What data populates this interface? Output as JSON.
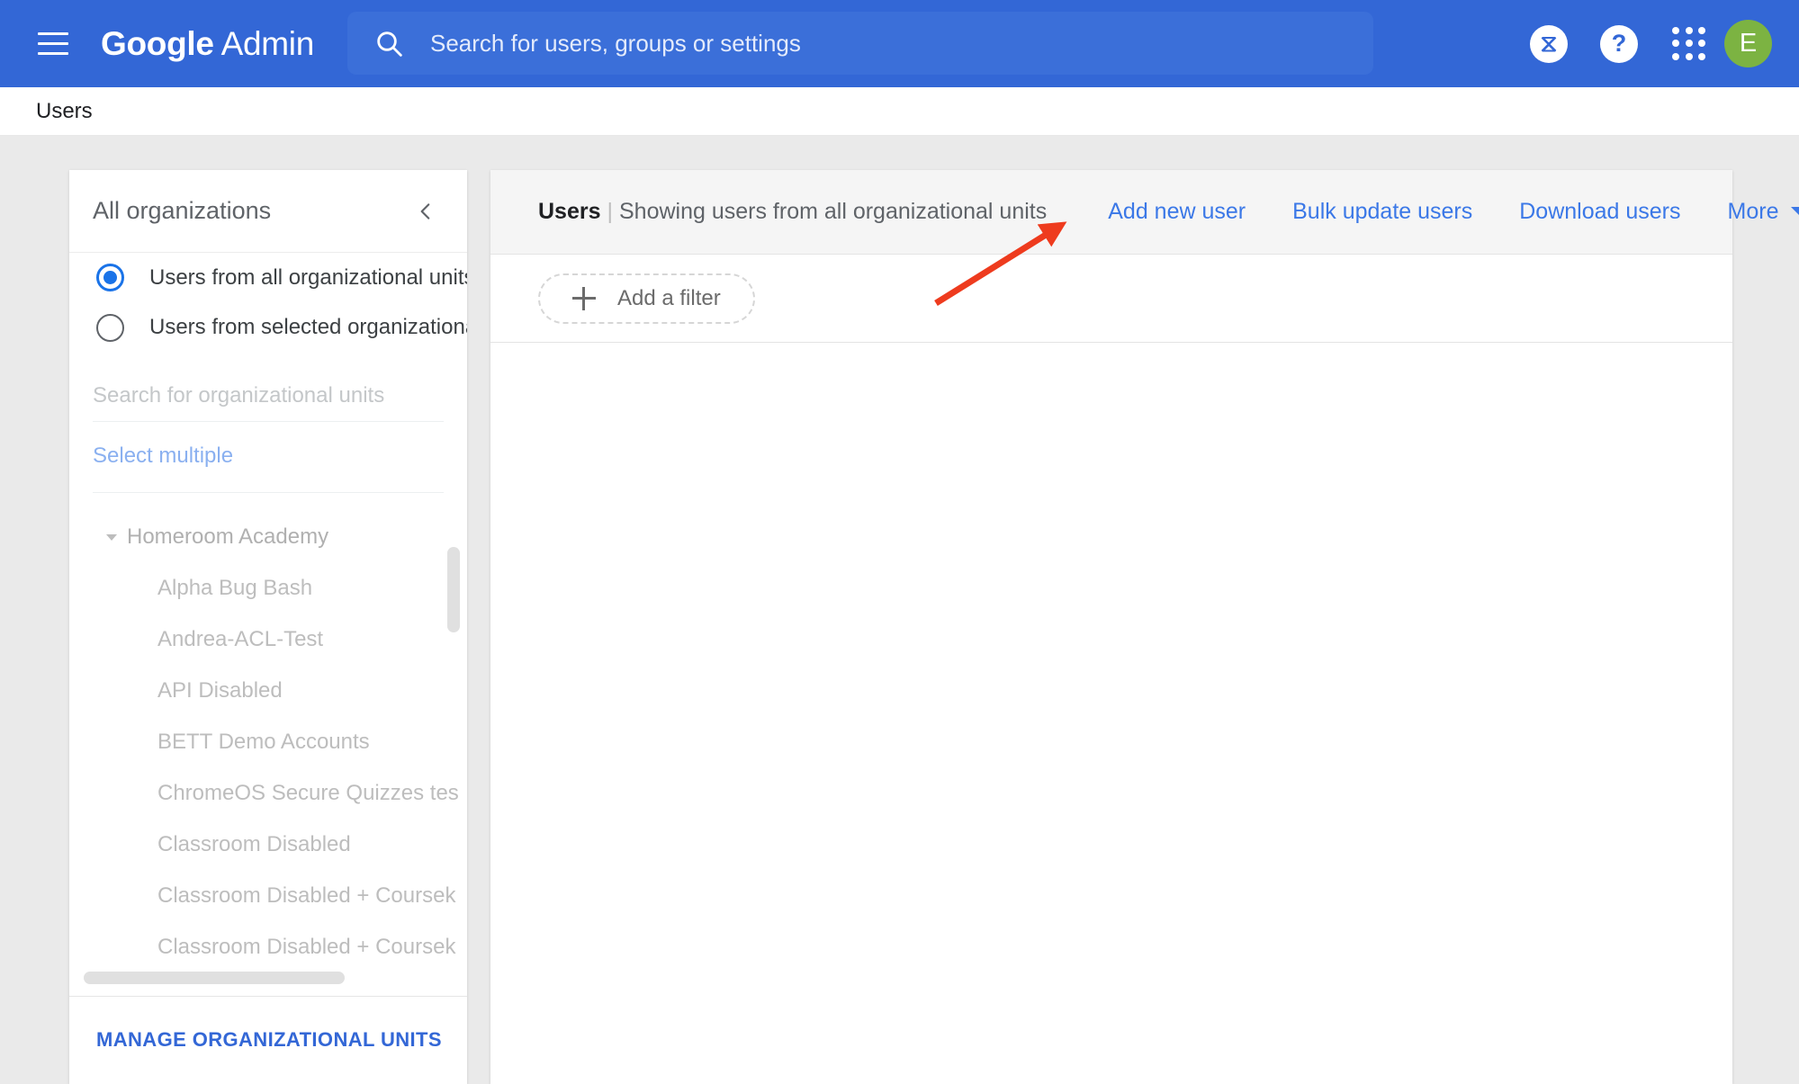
{
  "topbar": {
    "menu_icon": "hamburger-menu-icon",
    "brand_bold": "Google",
    "brand_light": "Admin",
    "search": {
      "icon": "search-icon",
      "placeholder": "Search for users, groups or settings",
      "value": ""
    },
    "hourglass_label": "⧖",
    "help_label": "?",
    "apps_icon": "apps-grid-icon",
    "avatar_initial": "E",
    "avatar_color": "#7cb342",
    "bar_color": "#3367d6"
  },
  "breadcrumb": {
    "label": "Users"
  },
  "org_panel": {
    "title": "All organizations",
    "collapse_icon": "chevron-left-icon",
    "radios": [
      {
        "label": "Users from all organizational units",
        "selected": true
      },
      {
        "label": "Users from selected organizational...",
        "selected": false
      }
    ],
    "search_placeholder": "Search for organizational units",
    "search_value": "",
    "select_multiple_label": "Select multiple",
    "tree": [
      {
        "label": "Homeroom Academy",
        "level": 0,
        "expanded": true
      },
      {
        "label": "Alpha Bug Bash",
        "level": 1
      },
      {
        "label": "Andrea-ACL-Test",
        "level": 1
      },
      {
        "label": "API Disabled",
        "level": 1
      },
      {
        "label": "BETT Demo Accounts",
        "level": 1
      },
      {
        "label": "ChromeOS Secure Quizzes tes",
        "level": 1
      },
      {
        "label": "Classroom Disabled",
        "level": 1
      },
      {
        "label": "Classroom Disabled + Coursek",
        "level": 1
      },
      {
        "label": "Classroom Disabled + Coursek",
        "level": 1
      }
    ],
    "manage_button": "MANAGE ORGANIZATIONAL UNITS"
  },
  "main": {
    "title_bold": "Users",
    "title_separator": "|",
    "title_sub": "Showing users from all organizational units",
    "actions": [
      {
        "label": "Add new user"
      },
      {
        "label": "Bulk update users"
      },
      {
        "label": "Download users"
      },
      {
        "label": "More",
        "has_caret": true
      }
    ],
    "filter": {
      "icon": "plus-icon",
      "label": "Add a filter"
    }
  },
  "annotation": {
    "type": "red-arrow",
    "color": "#ee3b1e",
    "points_to": "Add new user"
  }
}
